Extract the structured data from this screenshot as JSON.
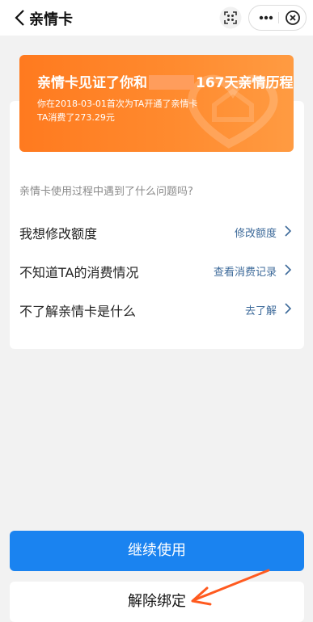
{
  "header": {
    "title": "亲情卡",
    "back_icon": "chevron-left-icon",
    "scan_icon": "scan-icon",
    "more_icon": "more-dots-icon",
    "close_icon": "close-circle-icon"
  },
  "banner": {
    "title_prefix": "亲情卡见证了你和",
    "title_suffix": "167天亲情历程",
    "line1": "你在2018-03-01首次为TA开通了亲情卡",
    "line2": "TA消费了273.29元",
    "color": "#ff7a1f"
  },
  "faq": {
    "question": "亲情卡使用过程中遇到了什么问题吗?",
    "items": [
      {
        "label": "我想修改额度",
        "link": "修改额度"
      },
      {
        "label": "不知道TA的消费情况",
        "link": "查看消费记录"
      },
      {
        "label": "不了解亲情卡是什么",
        "link": "去了解"
      }
    ],
    "link_color": "#3d6a9a"
  },
  "actions": {
    "continue_label": "继续使用",
    "unbind_label": "解除绑定",
    "primary_color": "#1a83f0",
    "annotation_color": "#ff5a1f"
  }
}
